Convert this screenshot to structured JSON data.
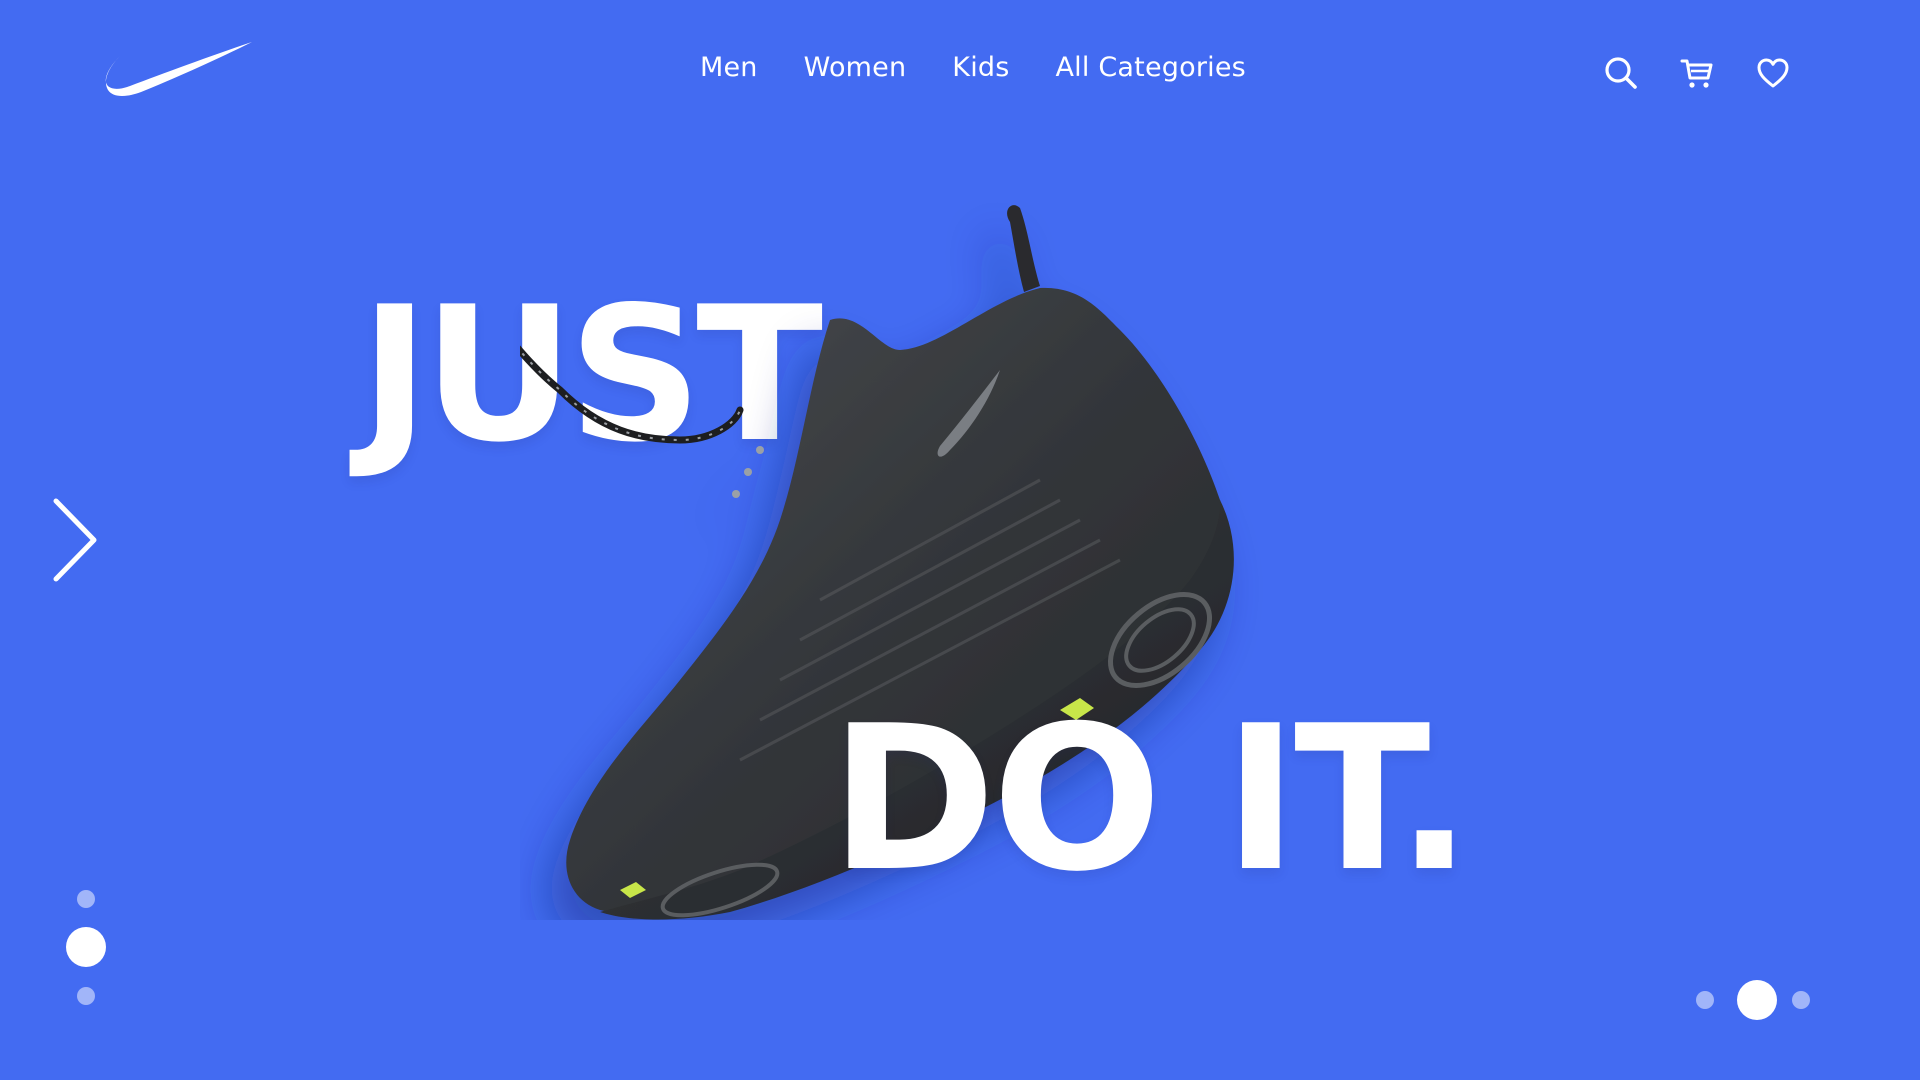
{
  "brand": {
    "logo_icon": "swoosh-logo-icon"
  },
  "nav": {
    "items": [
      {
        "label": "Men"
      },
      {
        "label": "Women"
      },
      {
        "label": "Kids"
      },
      {
        "label": "All Categories"
      }
    ]
  },
  "header_icons": [
    "search-icon",
    "cart-icon",
    "heart-icon"
  ],
  "hero": {
    "line1": "JUST",
    "line2": "DO IT.",
    "image": "running-shoe-image"
  },
  "carousel": {
    "next_icon": "chevron-right-icon",
    "vertical_dots_count": 3,
    "vertical_active_index": 1,
    "horizontal_dots_count": 3,
    "horizontal_active_index": 1
  },
  "colors": {
    "background": "#436bf2",
    "text": "#ffffff",
    "shoe_dark": "#2f3133",
    "accent_sole": "#c8e64a"
  }
}
